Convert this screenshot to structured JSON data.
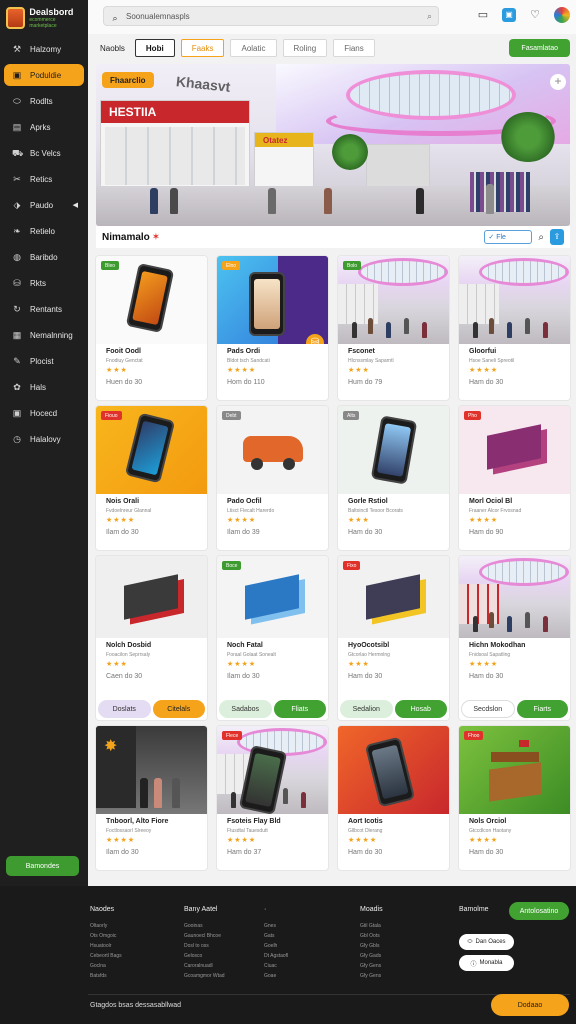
{
  "app": {
    "logo_title": "Dealsbord",
    "logo_subtitle": "ecommerce marketplace"
  },
  "sidebar": {
    "items": [
      {
        "label": "Halzomy",
        "icon": "wrench-icon"
      },
      {
        "label": "Poduldie",
        "icon": "box-icon",
        "active": true
      },
      {
        "label": "Rodlts",
        "icon": "pill-icon"
      },
      {
        "label": "Aprks",
        "icon": "clipboard-icon"
      },
      {
        "label": "Bc Velcs",
        "icon": "truck-icon"
      },
      {
        "label": "Retics",
        "icon": "scissors-icon"
      },
      {
        "label": "Paudo",
        "icon": "tag-icon",
        "has_caret": true
      },
      {
        "label": "Retielo",
        "icon": "leaf-icon"
      },
      {
        "label": "Baribdo",
        "icon": "globe-icon"
      },
      {
        "label": "Rkts",
        "icon": "cart-icon"
      },
      {
        "label": "Rentants",
        "icon": "refresh-icon"
      },
      {
        "label": "Nemalnning",
        "icon": "grid-icon"
      },
      {
        "label": "Plocist",
        "icon": "pen-icon"
      },
      {
        "label": "Hals",
        "icon": "palette-icon"
      },
      {
        "label": "Hocecd",
        "icon": "box-icon"
      },
      {
        "label": "Halalovy",
        "icon": "clock-icon"
      }
    ],
    "footer_button": "Bamondes"
  },
  "topbar": {
    "search_placeholder": "Soonualemnaspls"
  },
  "tabs": {
    "items": [
      {
        "label": "Naobls",
        "style": "plain"
      },
      {
        "label": "Hobi",
        "style": "sel"
      },
      {
        "label": "Faaks",
        "style": "orange"
      },
      {
        "label": "Aolatic",
        "style": "normal"
      },
      {
        "label": "Roling",
        "style": "normal"
      },
      {
        "label": "Fians",
        "style": "normal"
      }
    ],
    "action": "Fasamlatao"
  },
  "hero": {
    "badge": "Fhaarclio",
    "storefront_sign": "HESTIIA",
    "storefront_sign_2": "Otatez",
    "watermark": "Khaasvt"
  },
  "section": {
    "title": "Nimamalo",
    "filter_label": "Fle"
  },
  "colors": {
    "accent_orange": "#f6a31c",
    "accent_green": "#41a232",
    "accent_blue": "#2b9be0",
    "sidebar_bg": "#1f1f1f"
  },
  "products": [
    {
      "name": "Fooit Oodl",
      "sub": "Fnodiuy Genctat",
      "stars": "★★★",
      "price": "Huen do 30",
      "tag": "Bleo",
      "tag_color": "#3e9b2f",
      "art": "phone-orange"
    },
    {
      "name": "Pads Ordi",
      "sub": "Bldot tsch Sandcati",
      "stars": "★★★★",
      "price": "Hom do 110",
      "tag": "Elno",
      "tag_color": "#f6a31c",
      "art": "phone-blue"
    },
    {
      "name": "Fsconet",
      "sub": "Hlcnssmlay Saparntl",
      "stars": "★★★",
      "price": "Hum do 79",
      "tag": "Bolo",
      "tag_color": "#3e9b2f",
      "art": "mall"
    },
    {
      "name": "Gloorfui",
      "sub": "Hsoe Saneli Spreotil",
      "stars": "★★★★",
      "price": "Ham do 30",
      "tag": "",
      "tag_color": "",
      "art": "mall"
    },
    {
      "name": "Nois Orali",
      "sub": "Fvdoelnreur Glannal",
      "stars": "★★★★",
      "price": "Ilam do 30",
      "tag": "Fiouo",
      "tag_color": "#e0322a",
      "art": "phone-yellow"
    },
    {
      "name": "Pado Ocfil",
      "sub": "Ltisct Flecalt Harerdo",
      "stars": "★★★★",
      "price": "Ilam do 39",
      "tag": "Debt",
      "tag_color": "#888888",
      "art": "car"
    },
    {
      "name": "Gorle Rstiol",
      "sub": "Baltoinctl Tesoor Bcorats",
      "stars": "★★★",
      "price": "Ham do 30",
      "tag": "Alts",
      "tag_color": "#888888",
      "art": "phone-grey"
    },
    {
      "name": "Morl Ociol Bl",
      "sub": "Fraaner Alcor Frvosnad",
      "stars": "★★★★",
      "price": "Ham do 90",
      "tag": "Pho",
      "tag_color": "#e0322a",
      "art": "box-purple"
    },
    {
      "name": "Nolch Dosbid",
      "sub": "Fooacilon Seprrsaly",
      "stars": "★★★",
      "price": "Caen do 30",
      "tag": "",
      "tag_color": "",
      "art": "box-dark",
      "btns": [
        {
          "label": "Doslats",
          "style": "lilac"
        },
        {
          "label": "Citelals",
          "style": "orange"
        }
      ]
    },
    {
      "name": "Noch Fatal",
      "sub": "Poraal Golaat Sonealt",
      "stars": "★★★★",
      "price": "Ilam do 30",
      "tag": "Boce",
      "tag_color": "#3e9b2f",
      "art": "box-blue",
      "btns": [
        {
          "label": "Sadabos",
          "style": "mint"
        },
        {
          "label": "Fliats",
          "style": "green"
        }
      ]
    },
    {
      "name": "HyoOcotsibl",
      "sub": "Gtcorlao Hermnlng",
      "stars": "★★★",
      "price": "Ham do 30",
      "tag": "Fixo",
      "tag_color": "#e0322a",
      "art": "box-yellow",
      "btns": [
        {
          "label": "Sedalion",
          "style": "mint"
        },
        {
          "label": "Hosab",
          "style": "green"
        }
      ]
    },
    {
      "name": "Hichn Mokodhan",
      "sub": "Fnidsoal Sapatling",
      "stars": "★★★★",
      "price": "Ham do 30",
      "tag": "",
      "tag_color": "",
      "art": "mall-red",
      "btns": [
        {
          "label": "Secdslon",
          "style": "white"
        },
        {
          "label": "Fiarts",
          "style": "green"
        }
      ]
    },
    {
      "name": "Tnboorl, Alto Fiore",
      "sub": "Foctlossaorl Slreeoy",
      "stars": "★★★★",
      "price": "Ilam do 30",
      "tag": "",
      "tag_color": "",
      "art": "store-dark"
    },
    {
      "name": "Fsoteis Flay Bld",
      "sub": "Ftusdtal Tauesdutt",
      "stars": "★★★★",
      "price": "Ham do 37",
      "tag": "Flece",
      "tag_color": "#e0322a",
      "art": "mall-phone"
    },
    {
      "name": "Aort Icotis",
      "sub": "Gllbcot Dlerang",
      "stars": "★★★★",
      "price": "Ham do 30",
      "tag": "",
      "tag_color": "",
      "art": "phone-red"
    },
    {
      "name": "Nols Orciol",
      "sub": "Gtccdlcon Haotany",
      "stars": "★★★★",
      "price": "Ham do 30",
      "tag": "Fhoo",
      "tag_color": "#e0322a",
      "art": "kiosk"
    }
  ],
  "footer": {
    "columns": [
      {
        "title": "Naodes",
        "links": [
          "Oltaorly",
          "Ots Omgoic",
          "Hsuatoolr",
          "Cebeortl Bags",
          "Goclna",
          "Batsfds"
        ]
      },
      {
        "title": "Bany Aatel",
        "links": [
          "Gooinas",
          "Gaunoecl Bhcoe",
          "Dosl to oss",
          "Gelosco",
          "Caroralnuadl",
          "Gcoamgmor Wtad"
        ]
      },
      {
        "title": "·",
        "links": [
          "Gnes",
          "Gats",
          "Goelh",
          "Dt Agstaofl",
          "Ciuac",
          "Goae"
        ]
      },
      {
        "title": "Moadis",
        "links": [
          "Gtil Gtala",
          "Gbl Oots",
          "Gfy Gbls",
          "Gfy Gads",
          "Gfy Gens",
          "Gfy Gens"
        ]
      }
    ],
    "side_title": "Bamolme",
    "action": "Antolosatino",
    "pill_1": "Dan Oaces",
    "pill_2": "Monabla",
    "copyright": "Gtagdos bsas dessasabllwad",
    "bottom_button": "Dodaao"
  }
}
